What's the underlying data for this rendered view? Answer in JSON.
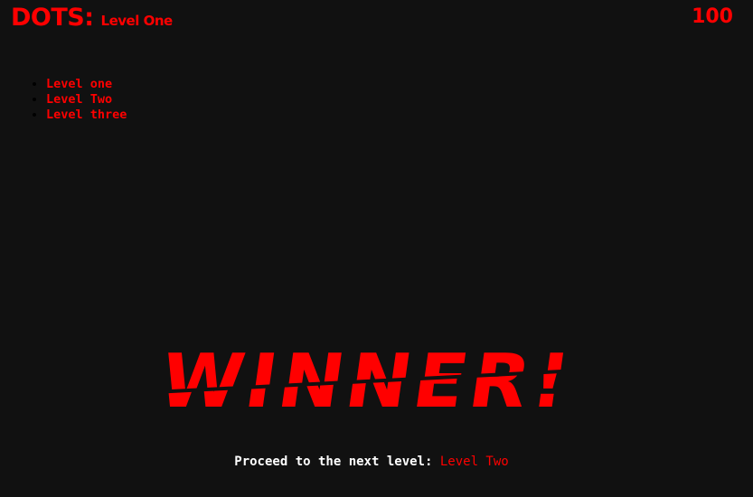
{
  "header": {
    "brand": "DOTS:",
    "level_name": "Level One",
    "score": "100"
  },
  "levels": [
    {
      "label": "Level one"
    },
    {
      "label": "Level Two"
    },
    {
      "label": "Level three"
    }
  ],
  "banner": {
    "text": "WINNER!"
  },
  "proceed": {
    "prompt": "Proceed to the next level:",
    "link_label": "Level Two"
  },
  "colors": {
    "background": "#111111",
    "accent": "#ff0000",
    "text": "#ffffff"
  }
}
